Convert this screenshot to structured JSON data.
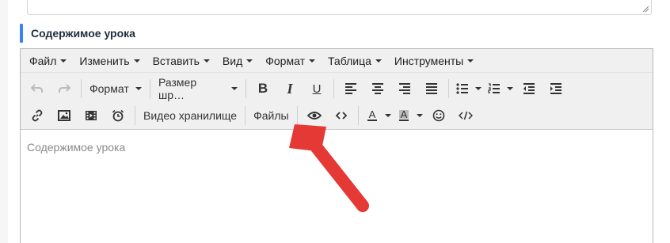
{
  "section": {
    "title": "Содержимое урока",
    "accent": "#3b82f6"
  },
  "menubar": {
    "items": [
      {
        "label": "Файл"
      },
      {
        "label": "Изменить"
      },
      {
        "label": "Вставить"
      },
      {
        "label": "Вид"
      },
      {
        "label": "Формат"
      },
      {
        "label": "Таблица"
      },
      {
        "label": "Инструменты"
      }
    ]
  },
  "toolbar": {
    "format_select": "Формат",
    "font_size_select": "Размер шр…",
    "bold": "B",
    "italic": "I",
    "underline": "U",
    "video_storage": "Видео хранилище",
    "files": "Файлы"
  },
  "editor": {
    "placeholder": "Содержимое урока"
  },
  "annotation": {
    "arrow_color": "#e53935"
  }
}
